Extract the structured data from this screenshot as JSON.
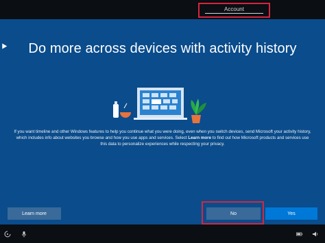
{
  "header": {
    "account_tab": "Account"
  },
  "main": {
    "title": "Do more across devices with activity history",
    "body_prefix": "If you want timeline and other Windows features to help you continue what you were doing, even when you switch devices, send Microsoft your activity history, which includes info about websites you browse and how you use apps and services. Select ",
    "body_bold": "Learn more",
    "body_suffix": " to find out how Microsoft products and services use this data to personalize experiences while respecting your privacy."
  },
  "buttons": {
    "learn_more": "Learn more",
    "no": "No",
    "yes": "Yes"
  },
  "colors": {
    "background": "#0a4c8c",
    "primary_button": "#0078d7",
    "secondary_button": "#3a6a9a",
    "highlight": "#d7263d"
  },
  "taskbar": {
    "icons": [
      "ease-of-access-icon",
      "microphone-icon",
      "battery-icon",
      "volume-icon"
    ]
  }
}
